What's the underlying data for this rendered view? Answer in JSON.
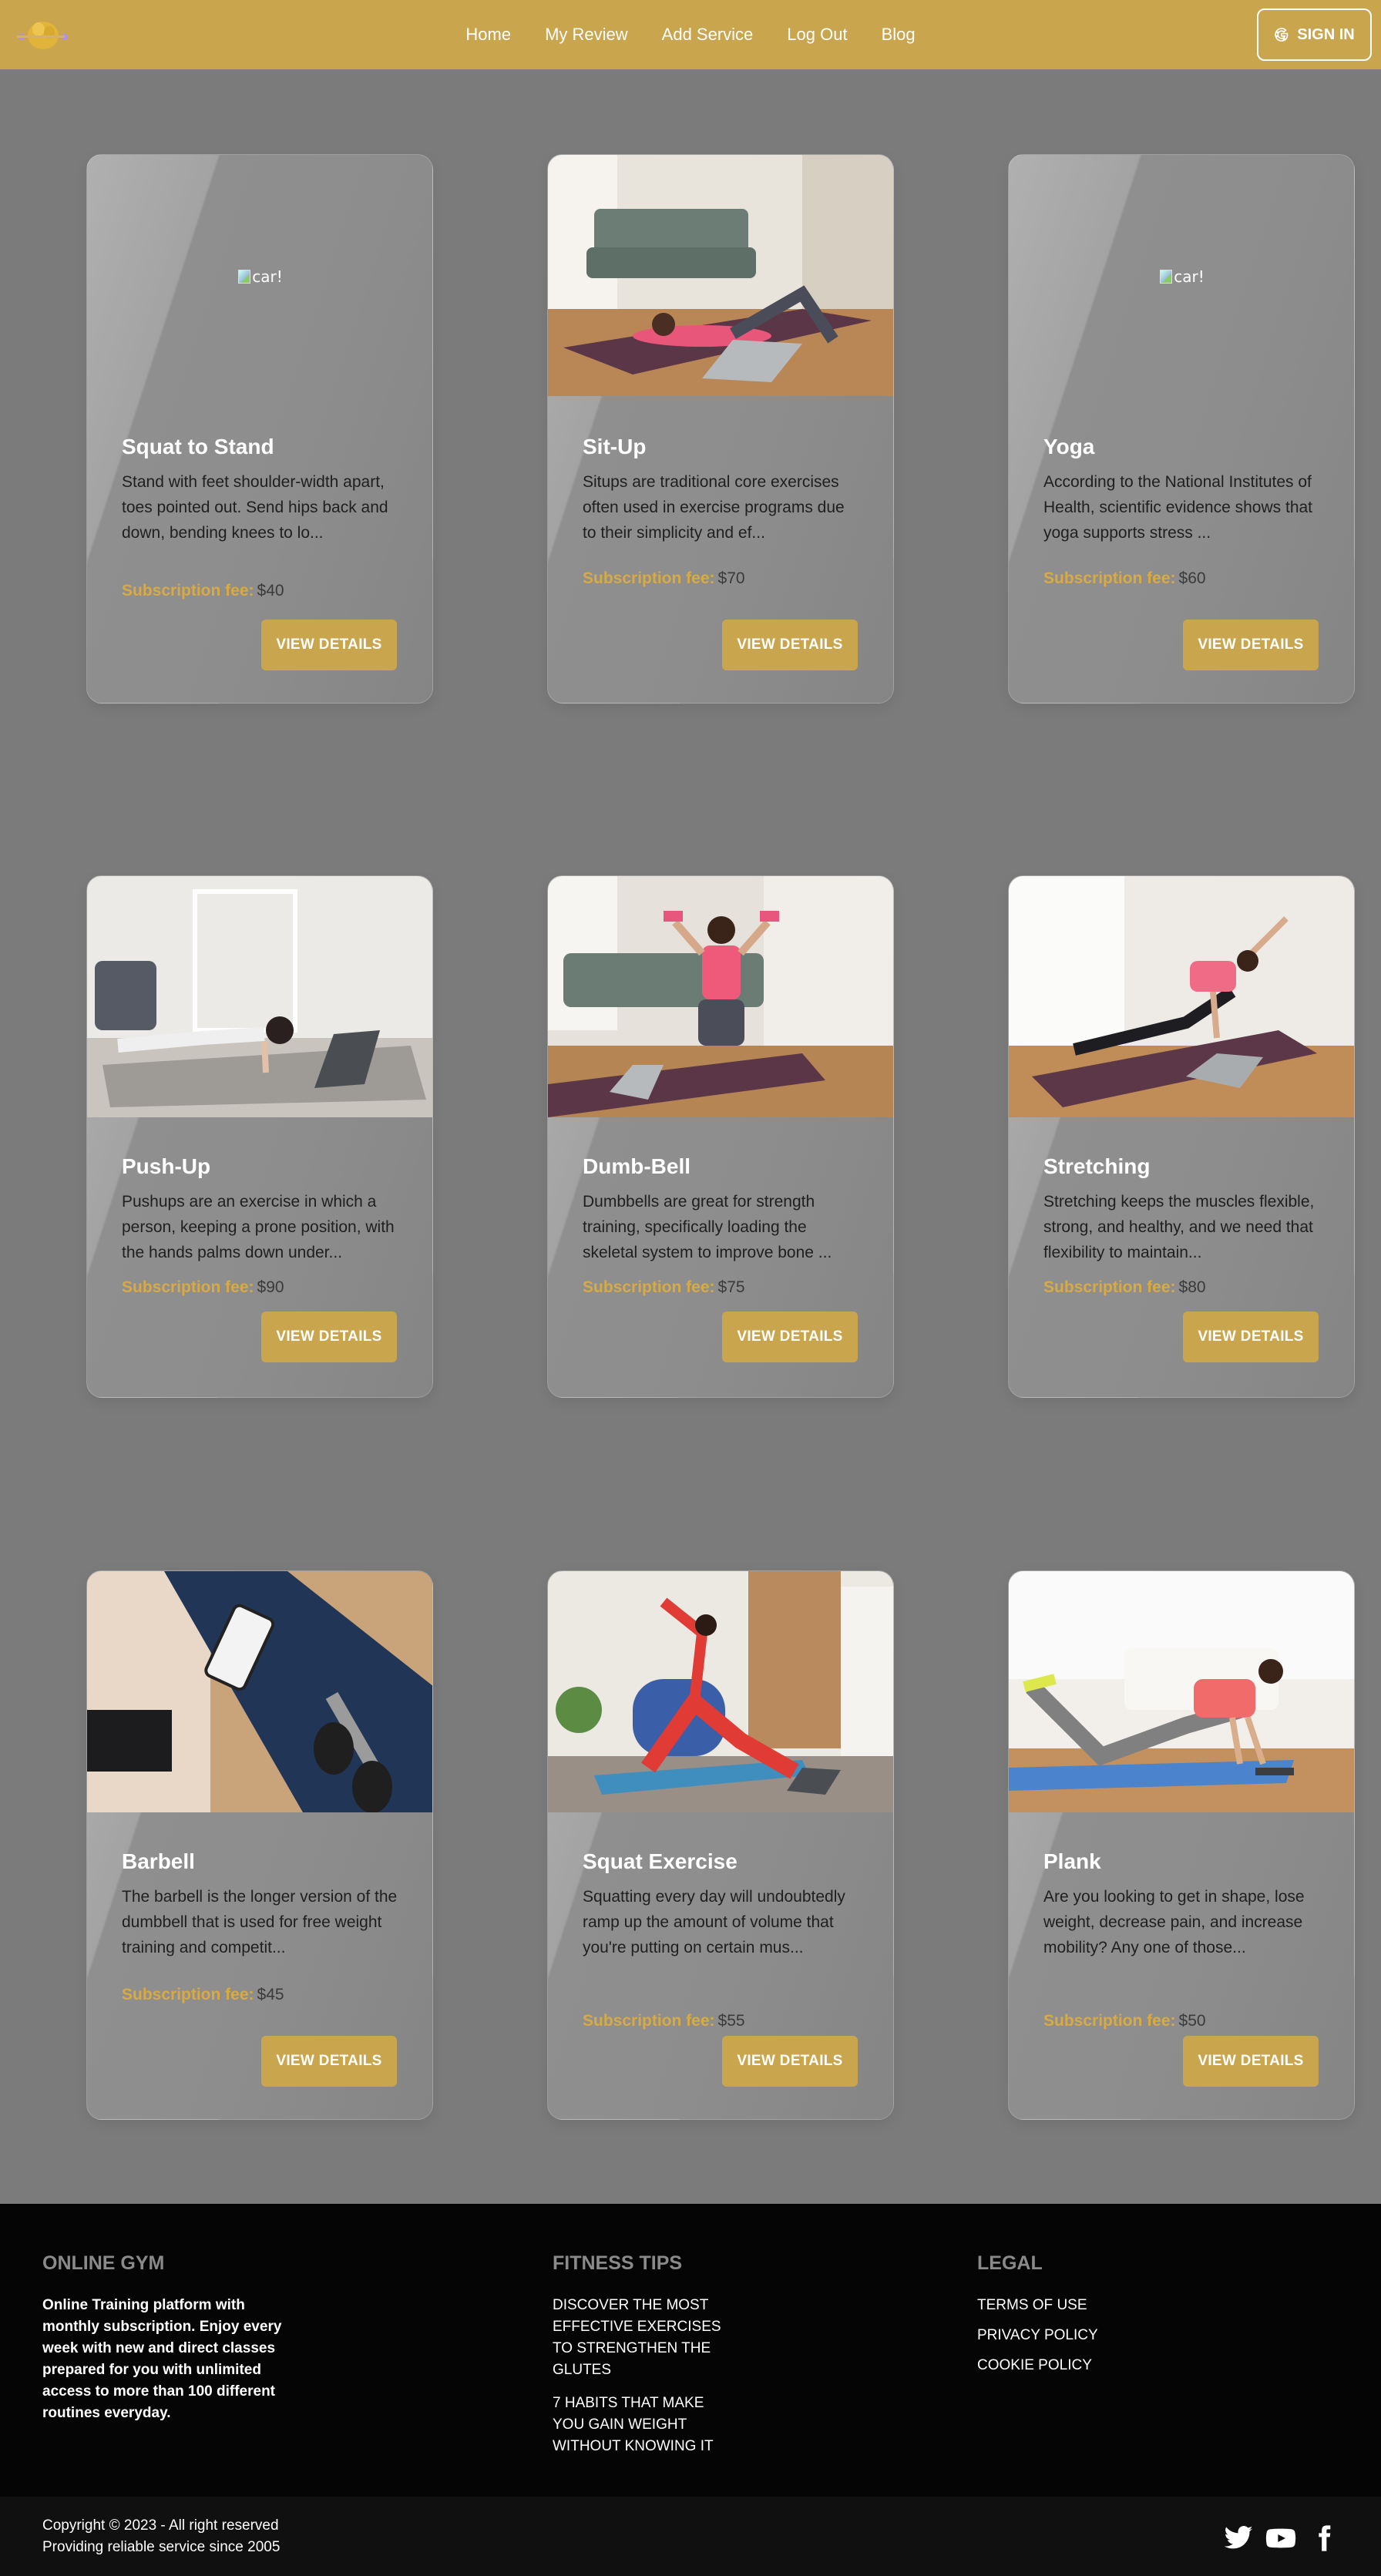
{
  "nav": {
    "links": [
      "Home",
      "My Review",
      "Add Service",
      "Log Out",
      "Blog"
    ],
    "signin_label": "SIGN IN",
    "signin_icon": "google-icon"
  },
  "colors": {
    "accent": "#c9a54e",
    "page_bg": "#7b7b7b",
    "fee_label": "#d9aa44",
    "footer_bg": "#050505"
  },
  "cards": [
    {
      "title": "Squat to Stand",
      "desc": "Stand with feet shoulder-width apart, toes pointed out. Send hips back and down, bending knees to lo...",
      "fee_label": "Subscription fee:",
      "fee": "$40",
      "button": "VIEW DETAILS",
      "image_alt": "car!",
      "image": "broken"
    },
    {
      "title": "Sit-Up",
      "desc": "Situps are traditional core exercises often used in exercise programs due to their simplicity and ef...",
      "fee_label": "Subscription fee:",
      "fee": "$70",
      "button": "VIEW DETAILS",
      "image": "woman doing sit-ups on purple mat in living room with laptop"
    },
    {
      "title": "Yoga",
      "desc": "According to the National Institutes of Health, scientific evidence shows that yoga supports stress ...",
      "fee_label": "Subscription fee:",
      "fee": "$60",
      "button": "VIEW DETAILS",
      "image_alt": "car!",
      "image": "broken"
    },
    {
      "title": "Push-Up",
      "desc": "Pushups are an exercise in which a person, keeping a prone position, with the hands palms down under...",
      "fee_label": "Subscription fee:",
      "fee": "$90",
      "button": "VIEW DETAILS",
      "image": "woman doing push-ups on rug facing laptop"
    },
    {
      "title": "Dumb-Bell",
      "desc": "Dumbbells are great for strength training, specifically loading the skeletal system to improve bone ...",
      "fee_label": "Subscription fee:",
      "fee": "$75",
      "button": "VIEW DETAILS",
      "image": "woman kneeling with pink dumbbells raised"
    },
    {
      "title": "Stretching",
      "desc": "Stretching keeps the muscles flexible, strong, and healthy, and we need that flexibility to maintain...",
      "fee_label": "Subscription fee:",
      "fee": "$80",
      "button": "VIEW DETAILS",
      "image": "woman doing side plank stretch on purple mat"
    },
    {
      "title": "Barbell",
      "desc": "The barbell is the longer version of the dumbbell that is used for free weight training and competit...",
      "fee_label": "Subscription fee:",
      "fee": "$45",
      "button": "VIEW DETAILS",
      "image": "woman holding phone next to dumbbell"
    },
    {
      "title": "Squat Exercise",
      "desc": "Squatting every day will undoubtedly ramp up the amount of volume that you're putting on certain mus...",
      "fee_label": "Subscription fee:",
      "fee": "$55",
      "button": "VIEW DETAILS",
      "image": "woman in red doing lunge stretch on blue mat"
    },
    {
      "title": "Plank",
      "desc": "Are you looking to get in shape, lose weight, decrease pain, and increase mobility? Any one of those...",
      "fee_label": "Subscription fee:",
      "fee": "$50",
      "button": "VIEW DETAILS",
      "image": "woman doing kneeling plank on blue mat with tablet"
    }
  ],
  "footer": {
    "col1_title": "ONLINE GYM",
    "col1_lines": [
      "Online Training platform with",
      "monthly subscription. Enjoy every",
      "week with new and direct classes",
      "prepared for you with unlimited",
      "access to more than 100 different",
      "routines everyday."
    ],
    "col2_title": "FITNESS TIPS",
    "tip1_lines": [
      "DISCOVER THE MOST",
      "EFFECTIVE EXERCISES",
      "TO STRENGTHEN THE",
      "GLUTES"
    ],
    "tip2_lines": [
      "7 HABITS THAT MAKE",
      "YOU GAIN WEIGHT",
      "WITHOUT KNOWING IT"
    ],
    "col3_title": "LEGAL",
    "legal_links": [
      "TERMS OF USE",
      "PRIVACY POLICY",
      "COOKIE POLICY"
    ],
    "copyright": "Copyright © 2023 - All right reserved",
    "tagline": "Providing reliable service since 2005",
    "social_icons": [
      "twitter-icon",
      "youtube-icon",
      "facebook-icon"
    ]
  }
}
